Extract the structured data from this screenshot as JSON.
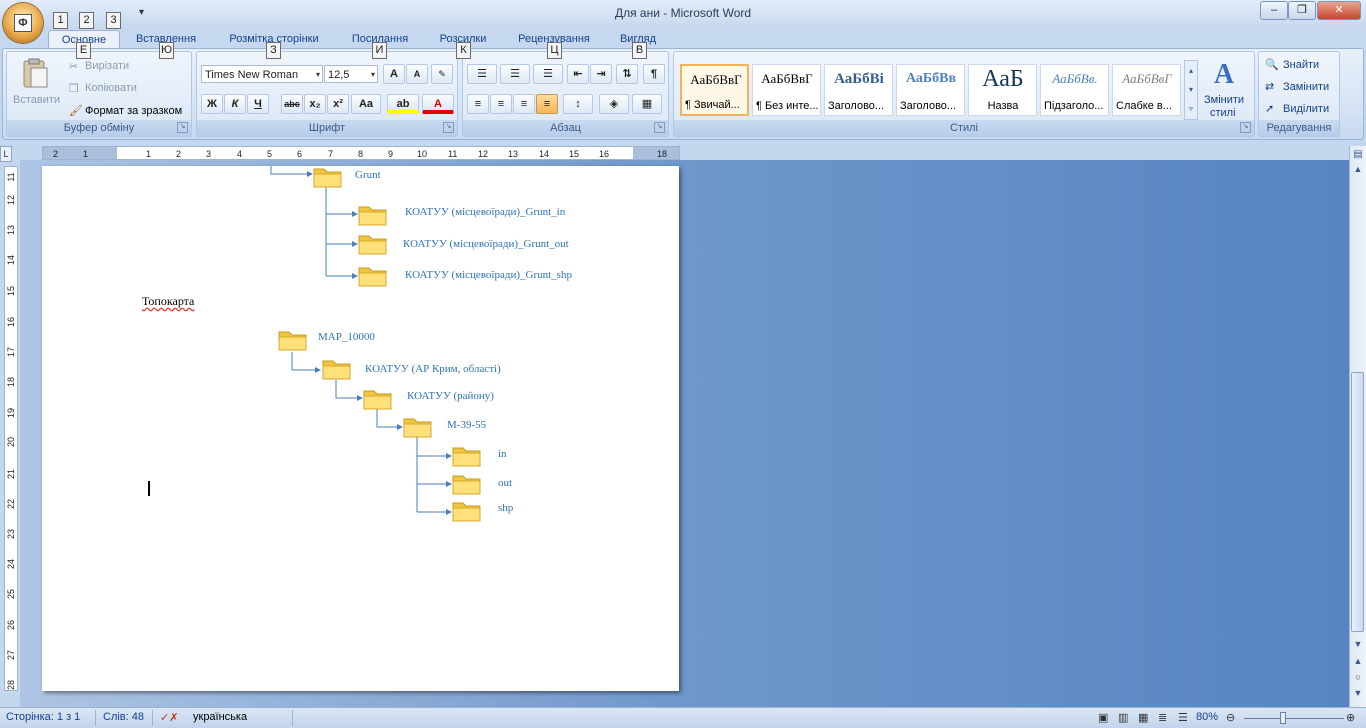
{
  "window": {
    "title": "Для ани - Microsoft Word",
    "minimize": "–",
    "restore": "❐",
    "close": "✕",
    "orb_letter": "Ф",
    "qat_keytips": [
      "1",
      "2",
      "3"
    ],
    "qat_dropdown": "▾"
  },
  "tabs": [
    {
      "label": "Основне",
      "keytip": "Е"
    },
    {
      "label": "Вставлення",
      "keytip": "Ю"
    },
    {
      "label": "Розмітка сторінки",
      "keytip": "З"
    },
    {
      "label": "Посилання",
      "keytip": "И"
    },
    {
      "label": "Розсилки",
      "keytip": "К"
    },
    {
      "label": "Рецензування",
      "keytip": "Ц"
    },
    {
      "label": "Вигляд",
      "keytip": "В"
    }
  ],
  "ribbon": {
    "clipboard": {
      "paste": "Вставити",
      "cut": "Вирізати",
      "copy": "Копіювати",
      "format_painter": "Формат за зразком",
      "label": "Буфер обміну"
    },
    "font": {
      "font_name": "Times New Roman",
      "font_size": "12,5",
      "label": "Шрифт",
      "bold": "Ж",
      "italic": "К",
      "underline": "Ч",
      "strike": "abc",
      "subscript": "x₂",
      "superscript": "x²",
      "change_case": "Aa",
      "grow": "A",
      "shrink": "A",
      "highlight": "ab",
      "font_color": "A"
    },
    "paragraph": {
      "label": "Абзац",
      "show_marks": "¶"
    },
    "styles": {
      "label": "Стилі",
      "items": [
        {
          "sample": "АаБбВвГ",
          "name": "¶ Звичай..."
        },
        {
          "sample": "АаБбВвГ",
          "name": "¶ Без инте..."
        },
        {
          "sample": "АаБбВі",
          "name": "Заголово..."
        },
        {
          "sample": "АаБбВв",
          "name": "Заголово..."
        },
        {
          "sample": "АаБ",
          "name": "Назва"
        },
        {
          "sample": "АаБбВв.",
          "name": "Підзаголо..."
        },
        {
          "sample": "АаБбВвГ",
          "name": "Слабке в..."
        }
      ],
      "change_styles": [
        "Змінити",
        "стилі"
      ]
    },
    "editing": {
      "label": "Редагування",
      "find": "Знайти",
      "replace": "Замінити",
      "select": "Виділити"
    }
  },
  "ruler": {
    "corner": "L",
    "h_ticks": [
      "2",
      "1",
      "1",
      "2",
      "3",
      "4",
      "5",
      "6",
      "7",
      "8",
      "9",
      "10",
      "11",
      "12",
      "13",
      "14",
      "15",
      "16",
      "18"
    ],
    "v_ticks": [
      "11",
      "12",
      "13",
      "14",
      "15",
      "16",
      "17",
      "18",
      "19",
      "20",
      "21",
      "22",
      "23",
      "24",
      "25",
      "26",
      "27",
      "28"
    ]
  },
  "document": {
    "tree1": [
      "Grunt",
      "КОАТУУ (місцевоїради)_Grunt_in",
      "КОАТУУ (місцевоїради)_Grunt_out",
      "КОАТУУ (місцевоїради)_Grunt_shp"
    ],
    "heading": "Топокарта",
    "tree2": [
      "MAP_10000",
      "КОАТУУ (АР Крим, області)",
      "КОАТУУ (району)",
      "M-39-55",
      "in",
      "out",
      "shp"
    ]
  },
  "status": {
    "page": "Сторінка: 1 з 1",
    "words": "Слів: 48",
    "language": "українська",
    "zoom": "80%"
  }
}
